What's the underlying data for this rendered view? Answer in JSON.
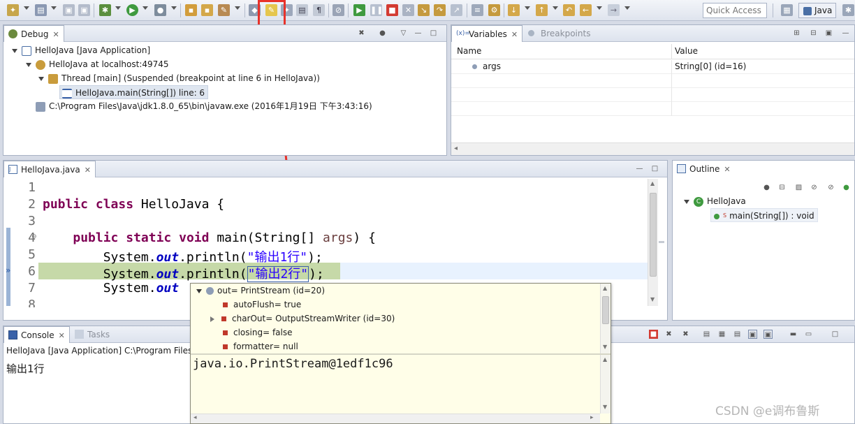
{
  "toolbar": {
    "quick_access_placeholder": "Quick Access",
    "perspective_label": "Java",
    "highlight_color": "#e8322a"
  },
  "debug_view": {
    "tab_label": "Debug",
    "tree": [
      {
        "label": "HelloJava [Java Application]"
      },
      {
        "label": "HelloJava at localhost:49745"
      },
      {
        "label": "Thread [main] (Suspended (breakpoint at line 6 in HelloJava))"
      },
      {
        "label": "HelloJava.main(String[]) line: 6"
      },
      {
        "label": "C:\\Program Files\\Java\\jdk1.8.0_65\\bin\\javaw.exe (2016年1月19日 下午3:43:16)"
      }
    ]
  },
  "variables_view": {
    "tab_label": "Variables",
    "tab2_label": "Breakpoints",
    "columns": [
      "Name",
      "Value"
    ],
    "rows": [
      {
        "name": "args",
        "value": "String[0]  (id=16)"
      }
    ]
  },
  "editor": {
    "tab_label": "HelloJava.java",
    "lines": [
      {
        "num": "1"
      },
      {
        "num": "2"
      },
      {
        "num": "3"
      },
      {
        "num": "4"
      },
      {
        "num": "5"
      },
      {
        "num": "6"
      },
      {
        "num": "7"
      },
      {
        "num": "8"
      }
    ],
    "tokens": {
      "l2_kw1": "public",
      "l2_kw2": "class",
      "l2_rest": "HelloJava {",
      "l4_kw1": "public",
      "l4_kw2": "static",
      "l4_kw3": "void",
      "l4_main": "main(String[]",
      "l4_args": "args",
      "l4_end": ") {",
      "sys": "System.",
      "out": "out",
      "println": ".println(",
      "s1": "\"输出1行\"",
      "s2": "\"输出2行\"",
      "end": ");"
    }
  },
  "outline_view": {
    "tab_label": "Outline",
    "class_name": "HelloJava",
    "method": "main(String[]) : void"
  },
  "console_view": {
    "tab_label": "Console",
    "tab2_label": "Tasks",
    "header": "HelloJava [Java Application] C:\\Program Files\\",
    "output": "输出1行"
  },
  "hover": {
    "root": "out= PrintStream  (id=20)",
    "children": [
      "autoFlush= true",
      "charOut= OutputStreamWriter  (id=30)",
      "closing= false",
      "formatter= null"
    ],
    "detail": "java.io.PrintStream@1edf1c96"
  },
  "watermark": "CSDN @e调布鲁斯"
}
